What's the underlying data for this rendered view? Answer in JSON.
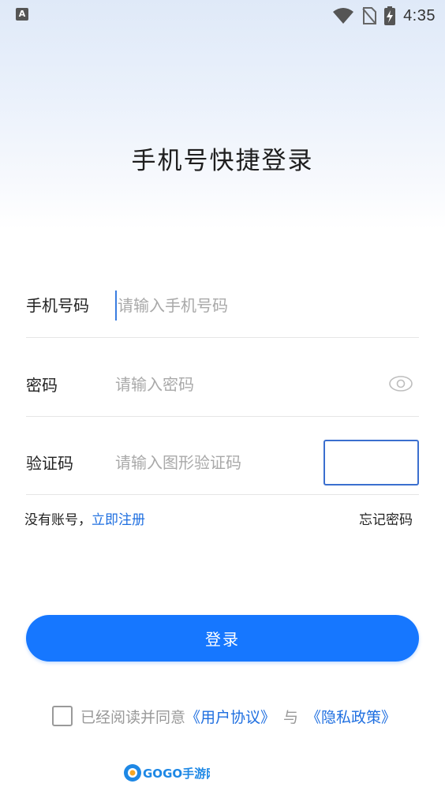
{
  "status_bar": {
    "app_icon_letter": "A",
    "time": "4:35"
  },
  "page": {
    "title": "手机号快捷登录"
  },
  "form": {
    "phone": {
      "label": "手机号码",
      "placeholder": "请输入手机号码",
      "value": ""
    },
    "password": {
      "label": "密码",
      "placeholder": "请输入密码",
      "value": ""
    },
    "captcha": {
      "label": "验证码",
      "placeholder": "请输入图形验证码",
      "value": ""
    }
  },
  "links": {
    "no_account": "没有账号，",
    "register": "立即注册",
    "forgot_password": "忘记密码"
  },
  "login_button": {
    "label": "登录"
  },
  "agreement": {
    "checked": false,
    "prefix": "已经阅读并同意",
    "user_agreement": "《用户协议》",
    "and": "与",
    "privacy_policy": "《隐私政策》"
  },
  "watermark": {
    "text": "GOGO手游网"
  },
  "colors": {
    "accent": "#1677ff",
    "link": "#1f6fe0",
    "placeholder": "#a9a9a9",
    "captcha_border": "#3b6fcf"
  }
}
